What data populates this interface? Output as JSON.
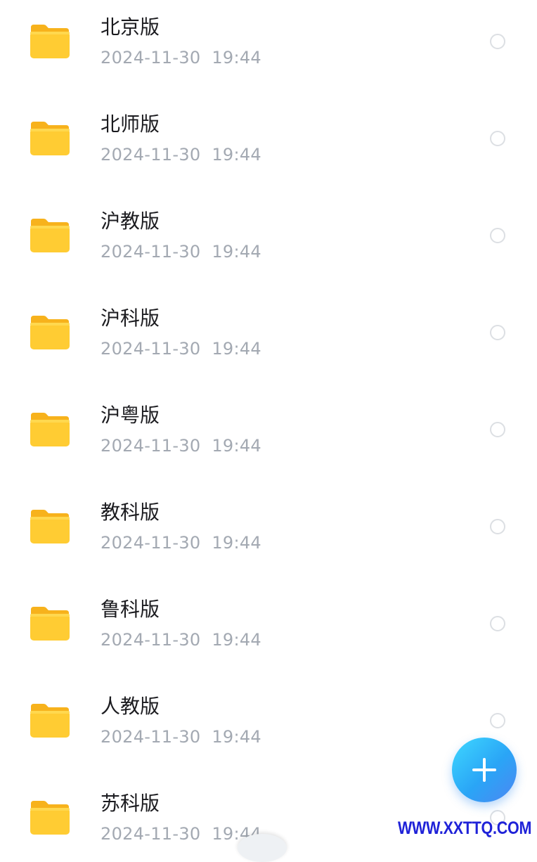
{
  "files": [
    {
      "name": "北京版",
      "date": "2024-11-30  19:44"
    },
    {
      "name": "北师版",
      "date": "2024-11-30  19:44"
    },
    {
      "name": "沪教版",
      "date": "2024-11-30  19:44"
    },
    {
      "name": "沪科版",
      "date": "2024-11-30  19:44"
    },
    {
      "name": "沪粤版",
      "date": "2024-11-30  19:44"
    },
    {
      "name": "教科版",
      "date": "2024-11-30  19:44"
    },
    {
      "name": "鲁科版",
      "date": "2024-11-30  19:44"
    },
    {
      "name": "人教版",
      "date": "2024-11-30  19:44"
    },
    {
      "name": "苏科版",
      "date": "2024-11-30  19:44"
    }
  ],
  "icons": {
    "folder": "folder-icon",
    "select": "radio-circle",
    "fab": "plus-icon"
  },
  "colors": {
    "folder": "#FFCC33",
    "name_text": "#1B1B1F",
    "date_text": "#A3A9B2",
    "fab_gradient_start": "#3FD8FF",
    "fab_gradient_end": "#4D86F2",
    "watermark": "#1F22D8"
  },
  "watermark": {
    "text": "WWW.XXTTQ.COM"
  }
}
